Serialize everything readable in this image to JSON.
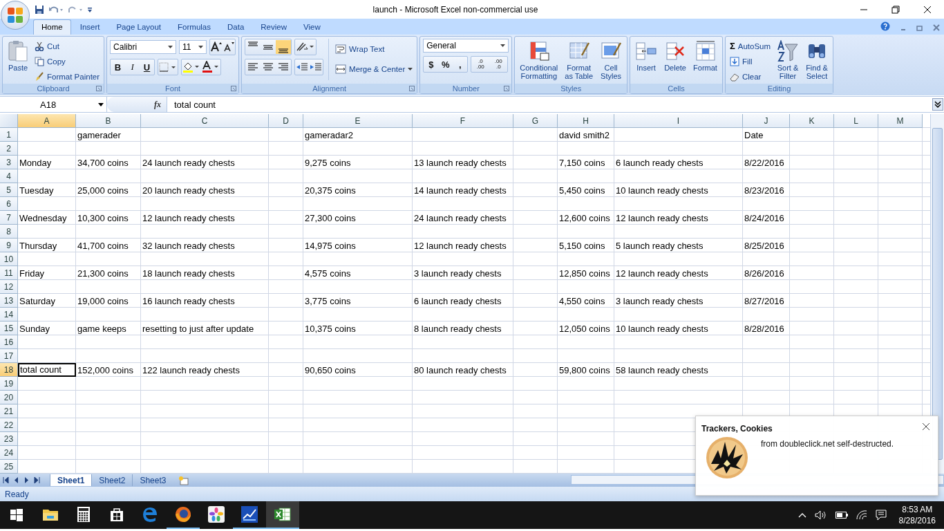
{
  "window": {
    "title": "launch - Microsoft Excel non-commercial use"
  },
  "tabs": [
    {
      "label": "Home",
      "selected": true
    },
    {
      "label": "Insert",
      "selected": false
    },
    {
      "label": "Page Layout",
      "selected": false
    },
    {
      "label": "Formulas",
      "selected": false
    },
    {
      "label": "Data",
      "selected": false
    },
    {
      "label": "Review",
      "selected": false
    },
    {
      "label": "View",
      "selected": false
    }
  ],
  "ribbon": {
    "clipboard": {
      "label": "Clipboard",
      "paste": "Paste",
      "cut": "Cut",
      "copy": "Copy",
      "format_painter": "Format Painter"
    },
    "font": {
      "label": "Font",
      "font_name": "Calibri",
      "font_size": "11",
      "bold": "B",
      "italic": "I",
      "underline": "U"
    },
    "alignment": {
      "label": "Alignment",
      "vertical_align": [
        {
          "selected": false
        },
        {
          "selected": false
        },
        {
          "selected": true
        }
      ],
      "wrap_text": "Wrap Text",
      "merge_center": "Merge & Center"
    },
    "number": {
      "label": "Number",
      "format": "General",
      "currency": "$",
      "percent": "%",
      "comma": ",",
      "decimals": [
        {
          "top": ".0",
          "bottom": ".00"
        },
        {
          "top": ".00",
          "bottom": ".0"
        }
      ]
    },
    "styles": {
      "label": "Styles",
      "buttons": [
        {
          "kind": "conditional",
          "lines": [
            "Conditional",
            "Formatting"
          ]
        },
        {
          "kind": "table",
          "lines": [
            "Format",
            "as Table"
          ]
        },
        {
          "kind": "cellstyle",
          "lines": [
            "Cell",
            "Styles"
          ]
        }
      ]
    },
    "cells": {
      "label": "Cells",
      "buttons": [
        {
          "kind": "insert",
          "lines": [
            "Insert"
          ]
        },
        {
          "kind": "delete",
          "lines": [
            "Delete"
          ]
        },
        {
          "kind": "format",
          "lines": [
            "Format"
          ]
        }
      ]
    },
    "editing": {
      "label": "Editing",
      "sigma": "Σ",
      "autosum": "AutoSum",
      "fill": "Fill",
      "clear": "Clear",
      "buttons": [
        {
          "kind": "sort",
          "lines": [
            "Sort &",
            "Filter"
          ]
        },
        {
          "kind": "find",
          "lines": [
            "Find &",
            "Select"
          ]
        }
      ]
    }
  },
  "formula_bar": {
    "name_box": "A18",
    "fx": "fx",
    "value": "total count"
  },
  "columns": [
    {
      "label": "A",
      "selected": true
    },
    {
      "label": "B",
      "selected": false
    },
    {
      "label": "C",
      "selected": false
    },
    {
      "label": "D",
      "selected": false
    },
    {
      "label": "E",
      "selected": false
    },
    {
      "label": "F",
      "selected": false
    },
    {
      "label": "G",
      "selected": false
    },
    {
      "label": "H",
      "selected": false
    },
    {
      "label": "I",
      "selected": false
    },
    {
      "label": "J",
      "selected": false
    },
    {
      "label": "K",
      "selected": false
    },
    {
      "label": "L",
      "selected": false
    },
    {
      "label": "M",
      "selected": false
    }
  ],
  "rows": [
    {
      "label": "1",
      "selected": false,
      "cells": [
        null,
        "gamerader",
        null,
        null,
        "gameradar2",
        null,
        null,
        "david smith2",
        null,
        "Date",
        null,
        null,
        null
      ]
    },
    {
      "label": "2",
      "selected": false
    },
    {
      "label": "3",
      "selected": false,
      "cells": [
        "Monday",
        "34,700 coins",
        "24 launch ready chests",
        null,
        "9,275 coins",
        "13 launch ready chests",
        null,
        "7,150 coins",
        "6 launch ready chests",
        "8/22/2016",
        null,
        null,
        null
      ]
    },
    {
      "label": "4",
      "selected": false
    },
    {
      "label": "5",
      "selected": false,
      "cells": [
        "Tuesday",
        "25,000 coins",
        "20 launch ready chests",
        null,
        "20,375 coins",
        "14 launch ready chests",
        null,
        "5,450 coins",
        "10 launch ready chests",
        "8/23/2016",
        null,
        null,
        null
      ]
    },
    {
      "label": "6",
      "selected": false
    },
    {
      "label": "7",
      "selected": false,
      "cells": [
        "Wednesday",
        "10,300 coins",
        "12 launch ready chests",
        null,
        "27,300 coins",
        "24 launch ready chests",
        null,
        "12,600 coins",
        "12 launch ready chests",
        "8/24/2016",
        null,
        null,
        null
      ]
    },
    {
      "label": "8",
      "selected": false
    },
    {
      "label": "9",
      "selected": false,
      "cells": [
        "Thursday",
        "41,700 coins",
        "32 launch ready chests",
        null,
        "14,975 coins",
        "12 launch ready chests",
        null,
        "5,150 coins",
        "5 launch ready chests",
        "8/25/2016",
        null,
        null,
        null
      ]
    },
    {
      "label": "10",
      "selected": false
    },
    {
      "label": "11",
      "selected": false,
      "cells": [
        "Friday",
        "21,300 coins",
        "18 launch ready chests",
        null,
        "4,575 coins",
        "3 launch ready chests",
        null,
        "12,850 coins",
        "12 launch ready chests",
        "8/26/2016",
        null,
        null,
        null
      ]
    },
    {
      "label": "12",
      "selected": false
    },
    {
      "label": "13",
      "selected": false,
      "cells": [
        "Saturday",
        "19,000 coins",
        "16 launch ready chests",
        null,
        "3,775 coins",
        "6 launch ready chests",
        null,
        "4,550 coins",
        "3 launch ready chests",
        "8/27/2016",
        null,
        null,
        null
      ]
    },
    {
      "label": "14",
      "selected": false
    },
    {
      "label": "15",
      "selected": false,
      "cells": [
        "Sunday",
        "game keeps",
        "resetting to just after update",
        null,
        "10,375 coins",
        "8 launch ready chests",
        null,
        "12,050 coins",
        "10 launch ready chests",
        "8/28/2016",
        null,
        null,
        null
      ]
    },
    {
      "label": "16",
      "selected": false
    },
    {
      "label": "17",
      "selected": false
    },
    {
      "label": "18",
      "selected": true,
      "cells": [
        "total count",
        "152,000 coins",
        "122 launch ready chests",
        null,
        "90,650 coins",
        "80 launch ready chests",
        null,
        "59,800 coins",
        "58 launch ready chests",
        null,
        null,
        null,
        null
      ]
    },
    {
      "label": "19",
      "selected": false
    },
    {
      "label": "20",
      "selected": false
    },
    {
      "label": "21",
      "selected": false
    },
    {
      "label": "22",
      "selected": false
    },
    {
      "label": "23",
      "selected": false
    },
    {
      "label": "24",
      "selected": false
    },
    {
      "label": "25",
      "selected": false
    }
  ],
  "sheet_tabs": [
    {
      "label": "Sheet1",
      "selected": true
    },
    {
      "label": "Sheet2",
      "selected": false
    },
    {
      "label": "Sheet3",
      "selected": false
    }
  ],
  "status_bar": {
    "text": "Ready"
  },
  "notification": {
    "title": "Trackers, Cookies",
    "message": "from doubleclick.net self-destructed."
  },
  "taskbar": {
    "apps": [
      {
        "kind": "explorer",
        "running": false,
        "active": false
      },
      {
        "kind": "calculator",
        "running": false,
        "active": false
      },
      {
        "kind": "store",
        "running": false,
        "active": false
      },
      {
        "kind": "edge",
        "running": false,
        "active": false
      },
      {
        "kind": "firefox",
        "running": true,
        "active": false
      },
      {
        "kind": "photos",
        "running": false,
        "active": false
      },
      {
        "kind": "chart",
        "running": true,
        "active": false
      },
      {
        "kind": "excel",
        "running": true,
        "active": true
      }
    ],
    "time": "8:53 AM",
    "date": "8/28/2016"
  }
}
